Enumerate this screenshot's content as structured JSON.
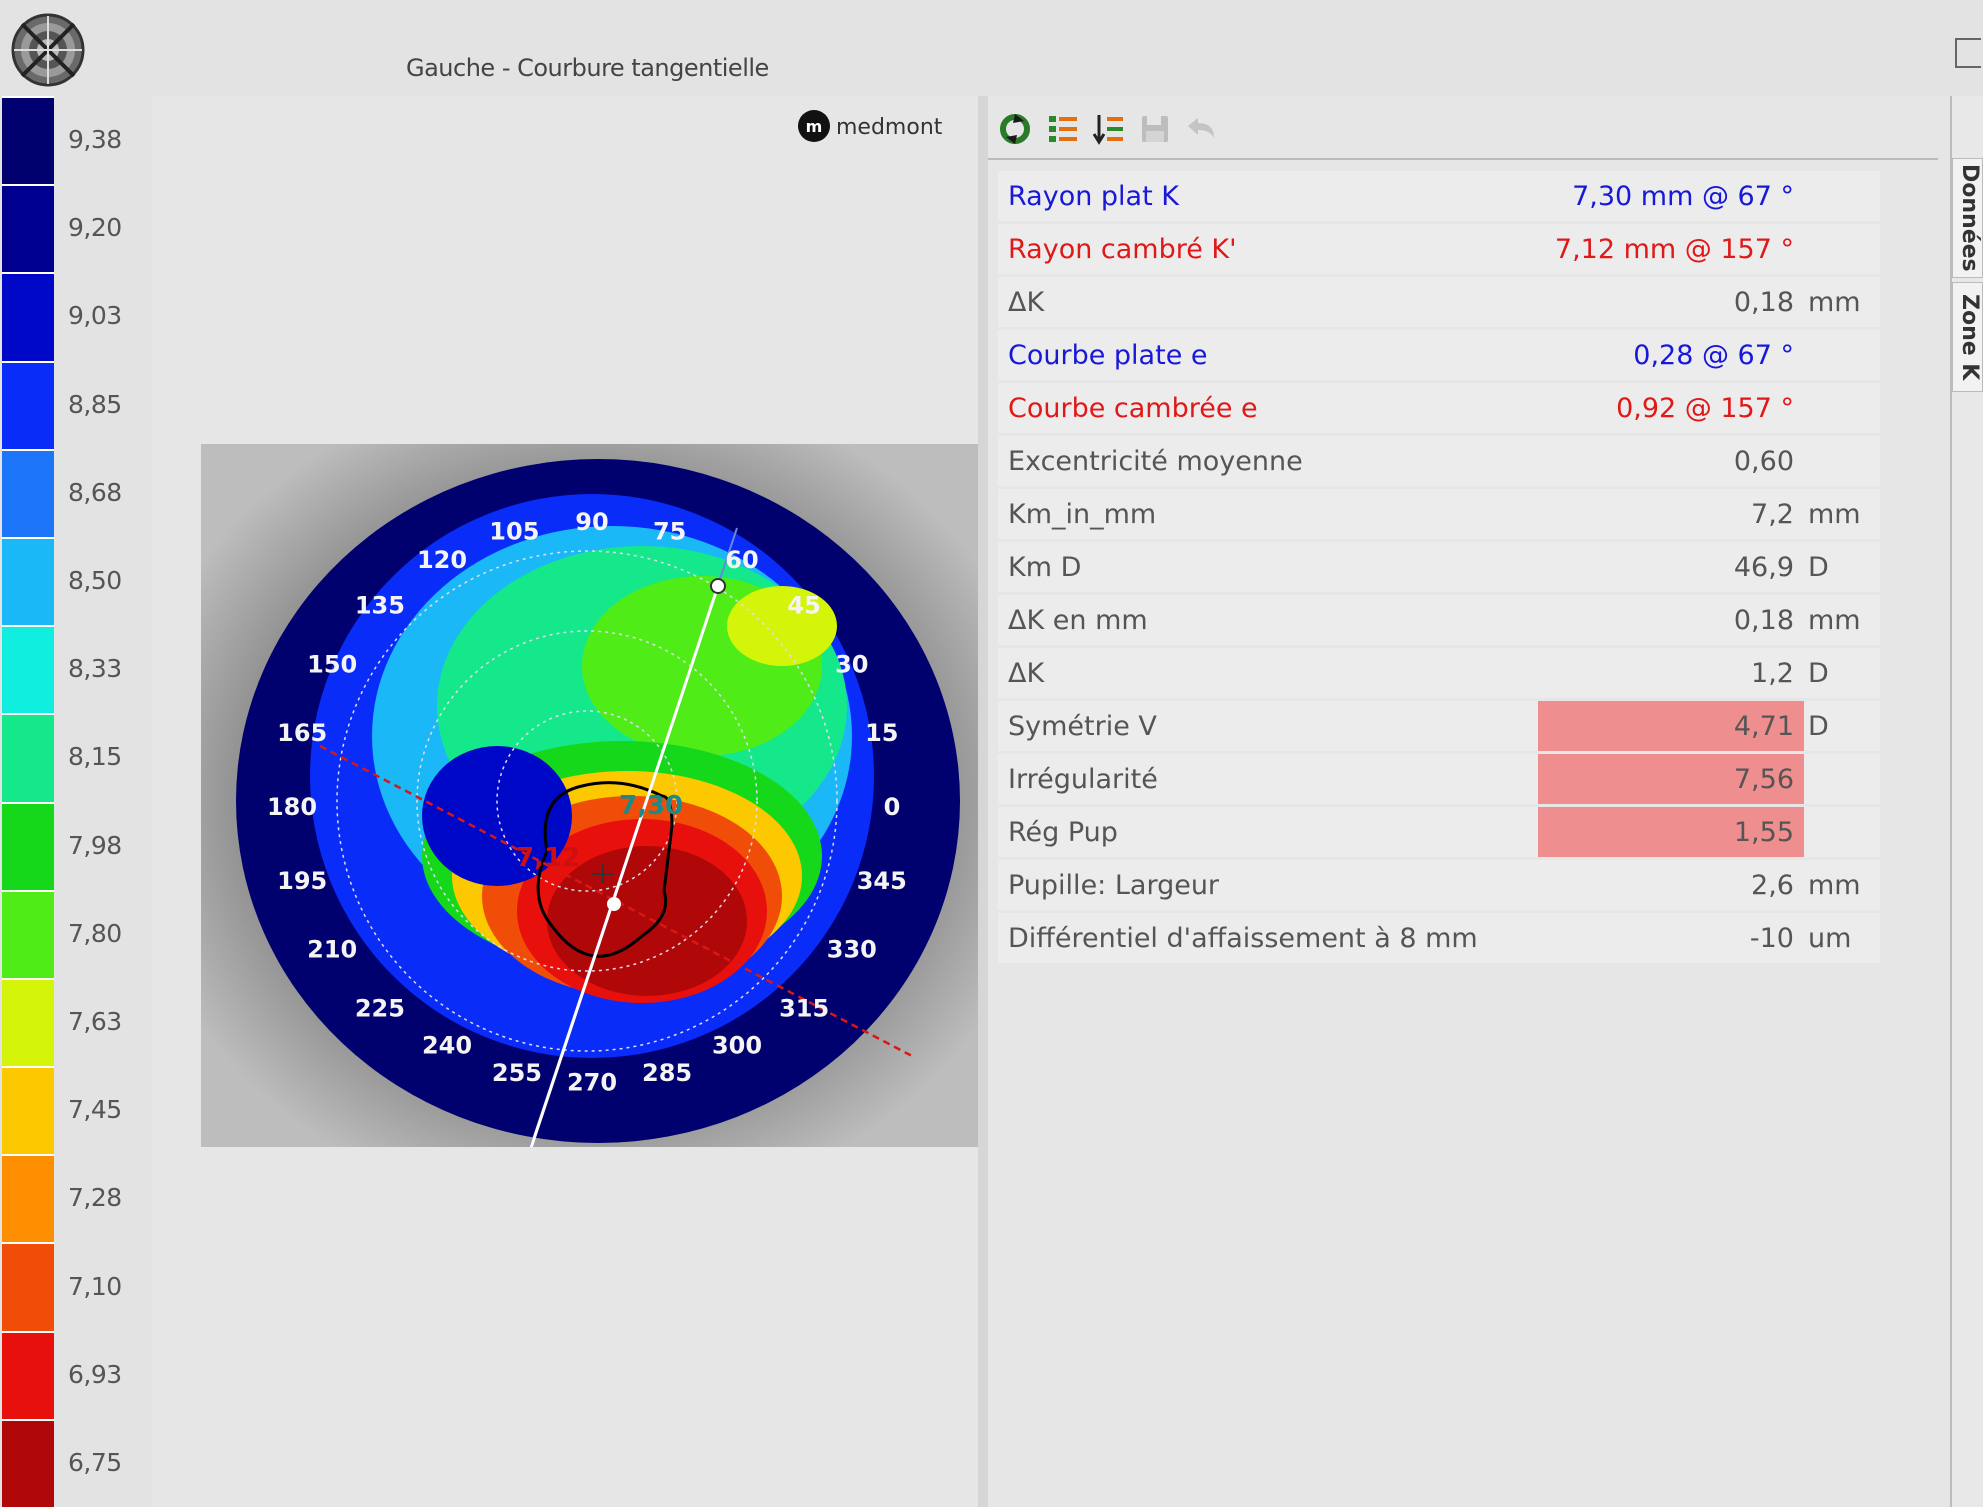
{
  "window": {
    "title": "Gauche - Courbure tangentielle"
  },
  "brand": {
    "text": "medmont"
  },
  "scale": {
    "labels": [
      "9,38",
      "9,20",
      "9,03",
      "8,85",
      "8,68",
      "8,50",
      "8,33",
      "8,15",
      "7,98",
      "7,80",
      "7,63",
      "7,45",
      "7,28",
      "7,10",
      "6,93",
      "6,75"
    ],
    "colors": [
      "#00006e",
      "#000090",
      "#0008c8",
      "#0a2cf8",
      "#1c74f8",
      "#1ab8f6",
      "#10eee0",
      "#14e88a",
      "#16d81a",
      "#50ec18",
      "#d4f40a",
      "#fcc800",
      "#fc8e00",
      "#f04e08",
      "#e8100c",
      "#b00808"
    ]
  },
  "map": {
    "angle_labels": [
      "90",
      "75",
      "60",
      "45",
      "30",
      "15",
      "0",
      "345",
      "330",
      "315",
      "300",
      "285",
      "270",
      "255",
      "240",
      "225",
      "210",
      "195",
      "180",
      "165",
      "150",
      "135",
      "120",
      "105"
    ],
    "flat_k_label": "7,30",
    "steep_k_label": "7,12"
  },
  "toolbar": {
    "icons": [
      "refresh-icon",
      "list-icon",
      "list-sort-icon",
      "save-icon",
      "undo-icon"
    ]
  },
  "params": [
    {
      "label": "Rayon plat K",
      "value": "7,30 mm @  67 °",
      "unit": "",
      "style": "blue",
      "alert": false
    },
    {
      "label": "Rayon cambré K'",
      "value": "7,12 mm @ 157 °",
      "unit": "",
      "style": "red",
      "alert": false
    },
    {
      "label": "ΔK",
      "value": "0,18",
      "unit": "mm",
      "style": "gray",
      "alert": false
    },
    {
      "label": "Courbe plate e",
      "value": "0,28 @  67 °",
      "unit": "",
      "style": "blue",
      "alert": false
    },
    {
      "label": "Courbe cambrée e",
      "value": "0,92 @ 157 °",
      "unit": "",
      "style": "red",
      "alert": false
    },
    {
      "label": "Excentricité moyenne",
      "value": "0,60",
      "unit": "",
      "style": "gray",
      "alert": false
    },
    {
      "label": "Km_in_mm",
      "value": "7,2",
      "unit": "mm",
      "style": "gray",
      "alert": false
    },
    {
      "label": "Km D",
      "value": "46,9",
      "unit": "D",
      "style": "gray",
      "alert": false
    },
    {
      "label": "ΔK en mm",
      "value": "0,18",
      "unit": "mm",
      "style": "gray",
      "alert": false
    },
    {
      "label": "ΔK",
      "value": "1,2",
      "unit": "D",
      "style": "gray",
      "alert": false
    },
    {
      "label": "Symétrie V",
      "value": "4,71",
      "unit": "D",
      "style": "gray",
      "alert": true
    },
    {
      "label": "Irrégularité",
      "value": "7,56",
      "unit": "",
      "style": "gray",
      "alert": true
    },
    {
      "label": "Rég Pup",
      "value": "1,55",
      "unit": "",
      "style": "gray",
      "alert": true
    },
    {
      "label": "Pupille: Largeur",
      "value": "2,6",
      "unit": "mm",
      "style": "gray",
      "alert": false
    },
    {
      "label": "Différentiel d'affaissement à 8 mm",
      "value": "-10",
      "unit": "um",
      "style": "gray",
      "alert": false
    }
  ],
  "side_tabs": [
    "Données",
    "Zone K"
  ]
}
